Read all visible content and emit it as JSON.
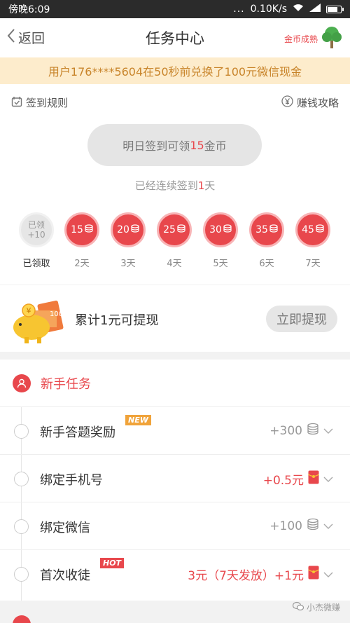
{
  "status_bar": {
    "time": "傍晚6:09",
    "dots": "...",
    "network_speed": "0.10K/s",
    "battery_level": 0.85
  },
  "nav": {
    "back_label": "返回",
    "title": "任务中心",
    "right_label": "金币成熟"
  },
  "banner": {
    "text": "用户176****5604在50秒前兑换了100元微信现金"
  },
  "signin": {
    "rules_label": "签到规则",
    "guide_label": "赚钱攻略",
    "pill_prefix": "明日签到可领",
    "pill_amount": "15",
    "pill_suffix": "金币",
    "streak_prefix": "已经连续签到",
    "streak_days": "1",
    "streak_suffix": "天",
    "days": [
      {
        "line1": "已领",
        "line2": "+10",
        "label": "已领取",
        "claimed": true
      },
      {
        "value": "15",
        "label": "2天",
        "claimed": false
      },
      {
        "value": "20",
        "label": "3天",
        "claimed": false
      },
      {
        "value": "25",
        "label": "4天",
        "claimed": false
      },
      {
        "value": "30",
        "label": "5天",
        "claimed": false
      },
      {
        "value": "35",
        "label": "6天",
        "claimed": false
      },
      {
        "value": "45",
        "label": "7天",
        "claimed": false
      }
    ]
  },
  "withdraw": {
    "piggy_text": "100",
    "text": "累计1元可提现",
    "button_label": "立即提现"
  },
  "tasks": {
    "header_title": "新手任务",
    "items": [
      {
        "name": "新手答题奖励",
        "badge": "NEW",
        "reward": "+300",
        "reward_type": "coin"
      },
      {
        "name": "绑定手机号",
        "badge": "",
        "reward": "+0.5元",
        "reward_type": "cash"
      },
      {
        "name": "绑定微信",
        "badge": "",
        "reward": "+100",
        "reward_type": "coin"
      },
      {
        "name": "首次收徒",
        "badge": "HOT",
        "reward": "3元（7天发放）+1元",
        "reward_type": "cash"
      }
    ]
  },
  "watermark": "小杰微赚",
  "colors": {
    "accent": "#e8474c",
    "banner_bg": "#fdeccc",
    "banner_text": "#c8842a",
    "new_badge": "#f0a33a",
    "tree": "#4caf50"
  }
}
